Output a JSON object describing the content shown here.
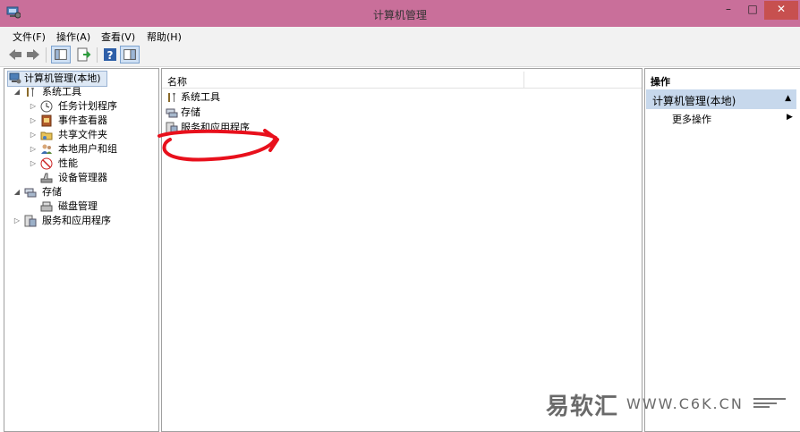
{
  "window": {
    "title": "计算机管理",
    "controls": {
      "minimize": "–",
      "maximize": "□",
      "close": "✕"
    }
  },
  "menubar": [
    "文件(F)",
    "操作(A)",
    "查看(V)",
    "帮助(H)"
  ],
  "toolbar": {
    "icons": [
      "back-icon",
      "forward-icon",
      "show-hide-tree-icon",
      "export-list-icon",
      "help-icon",
      "action-pane-icon"
    ]
  },
  "tree": {
    "root": "计算机管理(本地)",
    "items": [
      {
        "label": "系统工具",
        "icon": "tools-icon",
        "expander": "◢"
      },
      {
        "label": "任务计划程序",
        "icon": "clock-icon",
        "expander": "▷"
      },
      {
        "label": "事件查看器",
        "icon": "event-viewer-icon",
        "expander": "▷"
      },
      {
        "label": "共享文件夹",
        "icon": "shared-folder-icon",
        "expander": "▷"
      },
      {
        "label": "本地用户和组",
        "icon": "users-icon",
        "expander": "▷"
      },
      {
        "label": "性能",
        "icon": "performance-icon",
        "expander": "▷"
      },
      {
        "label": "设备管理器",
        "icon": "device-manager-icon",
        "expander": ""
      },
      {
        "label": "存储",
        "icon": "storage-icon",
        "expander": "◢"
      },
      {
        "label": "磁盘管理",
        "icon": "disk-icon",
        "expander": ""
      },
      {
        "label": "服务和应用程序",
        "icon": "services-icon",
        "expander": "▷"
      }
    ]
  },
  "list": {
    "column_name": "名称",
    "items": [
      {
        "label": "系统工具",
        "icon": "tools-icon"
      },
      {
        "label": "存储",
        "icon": "storage-icon"
      },
      {
        "label": "服务和应用程序",
        "icon": "services-icon"
      }
    ]
  },
  "actions": {
    "header": "操作",
    "section": "计算机管理(本地)",
    "section_arrow": "▲",
    "item": "更多操作",
    "item_arrow": "▶"
  },
  "watermark": {
    "brand": "易软汇",
    "url": "WWW.C6K.CN"
  },
  "colors": {
    "titlebar": "#c96f9a",
    "close_button": "#c7504f",
    "action_section": "#c7d8ec",
    "annotation": "#e8101c"
  }
}
